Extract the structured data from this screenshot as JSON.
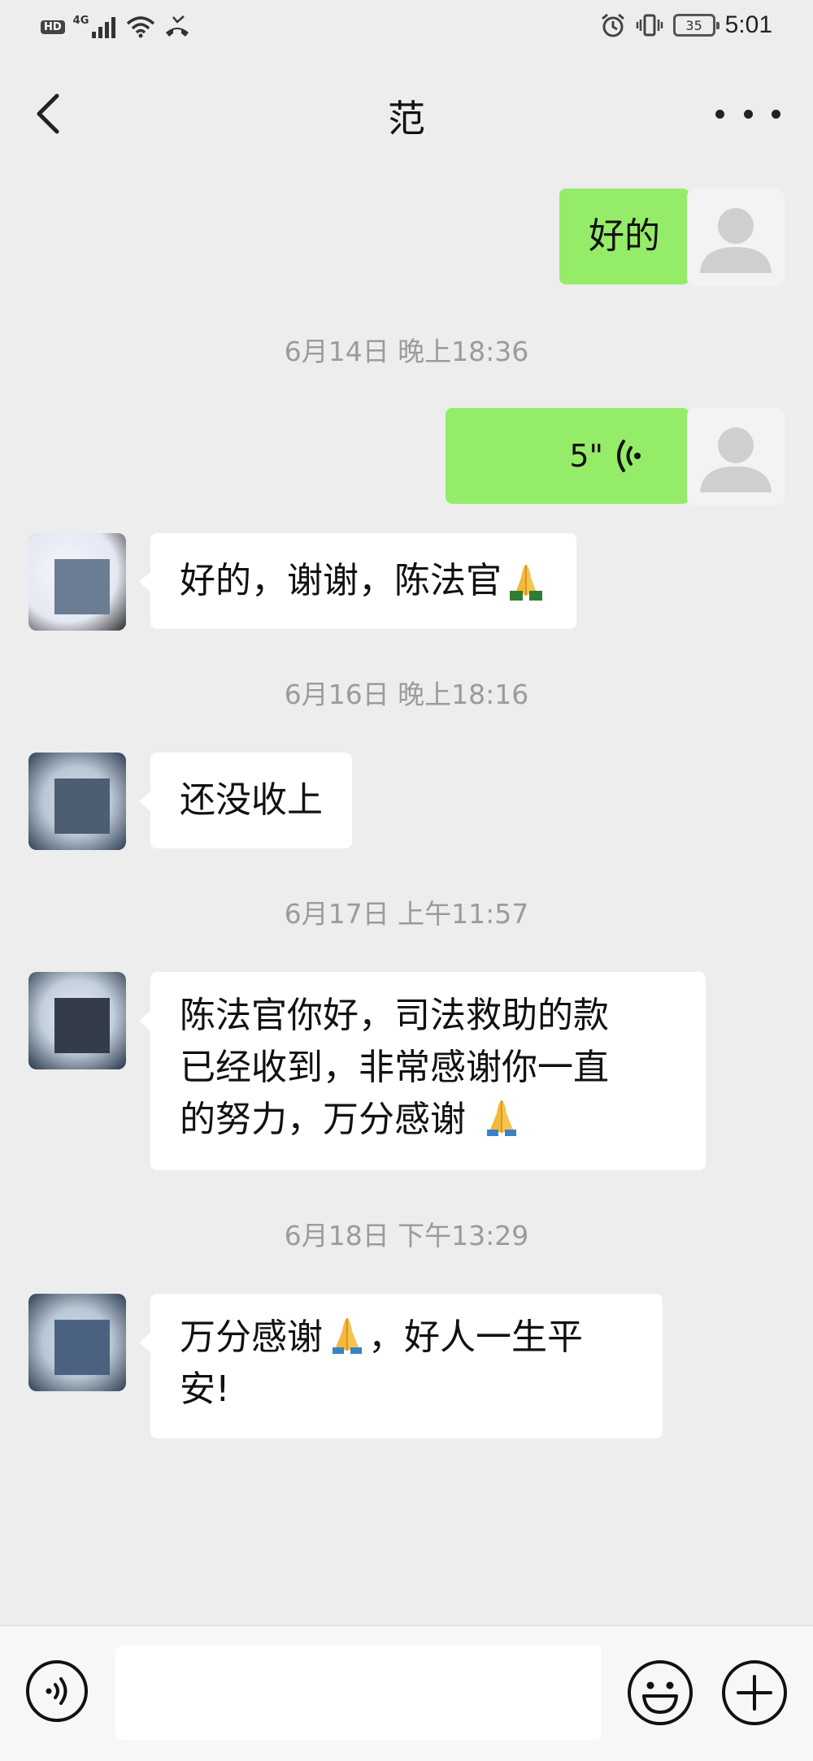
{
  "status_bar": {
    "hd_label": "HD",
    "network_label": "4G",
    "battery_level": "35",
    "time": "5:01"
  },
  "header": {
    "title": "范",
    "back_icon": "chevron-left-icon",
    "more_icon": "more-dots-icon"
  },
  "messages": [
    {
      "type": "text",
      "side": "self",
      "text": "好的"
    },
    {
      "type": "timestamp",
      "text": "6月14日 晚上18:36"
    },
    {
      "type": "voice",
      "side": "self",
      "duration": "5\""
    },
    {
      "type": "text",
      "side": "other",
      "text": "好的，谢谢，陈法官",
      "emoji": "folded-hands"
    },
    {
      "type": "timestamp",
      "text": "6月16日 晚上18:16"
    },
    {
      "type": "text",
      "side": "other",
      "text": "还没收上"
    },
    {
      "type": "timestamp",
      "text": "6月17日 上午11:57"
    },
    {
      "type": "text",
      "side": "other",
      "lines": [
        "陈法官你好，司法救助的款",
        "已经收到，非常感谢你一直",
        "的努力，万分感谢"
      ],
      "emoji": "folded-hands"
    },
    {
      "type": "timestamp",
      "text": "6月18日 下午13:29"
    },
    {
      "type": "text",
      "side": "other",
      "line1_before": "万分感谢",
      "line1_after": "，好人一生平",
      "line2": "安!",
      "emoji": "folded-hands"
    }
  ],
  "input_bar": {
    "voice_icon": "voice-input-icon",
    "input_value": "",
    "emoji_icon": "emoji-icon",
    "plus_icon": "plus-icon"
  },
  "colors": {
    "background": "#ededed",
    "self_bubble": "#95ec69",
    "other_bubble": "#ffffff",
    "timestamp_text": "#9b9b9b"
  }
}
